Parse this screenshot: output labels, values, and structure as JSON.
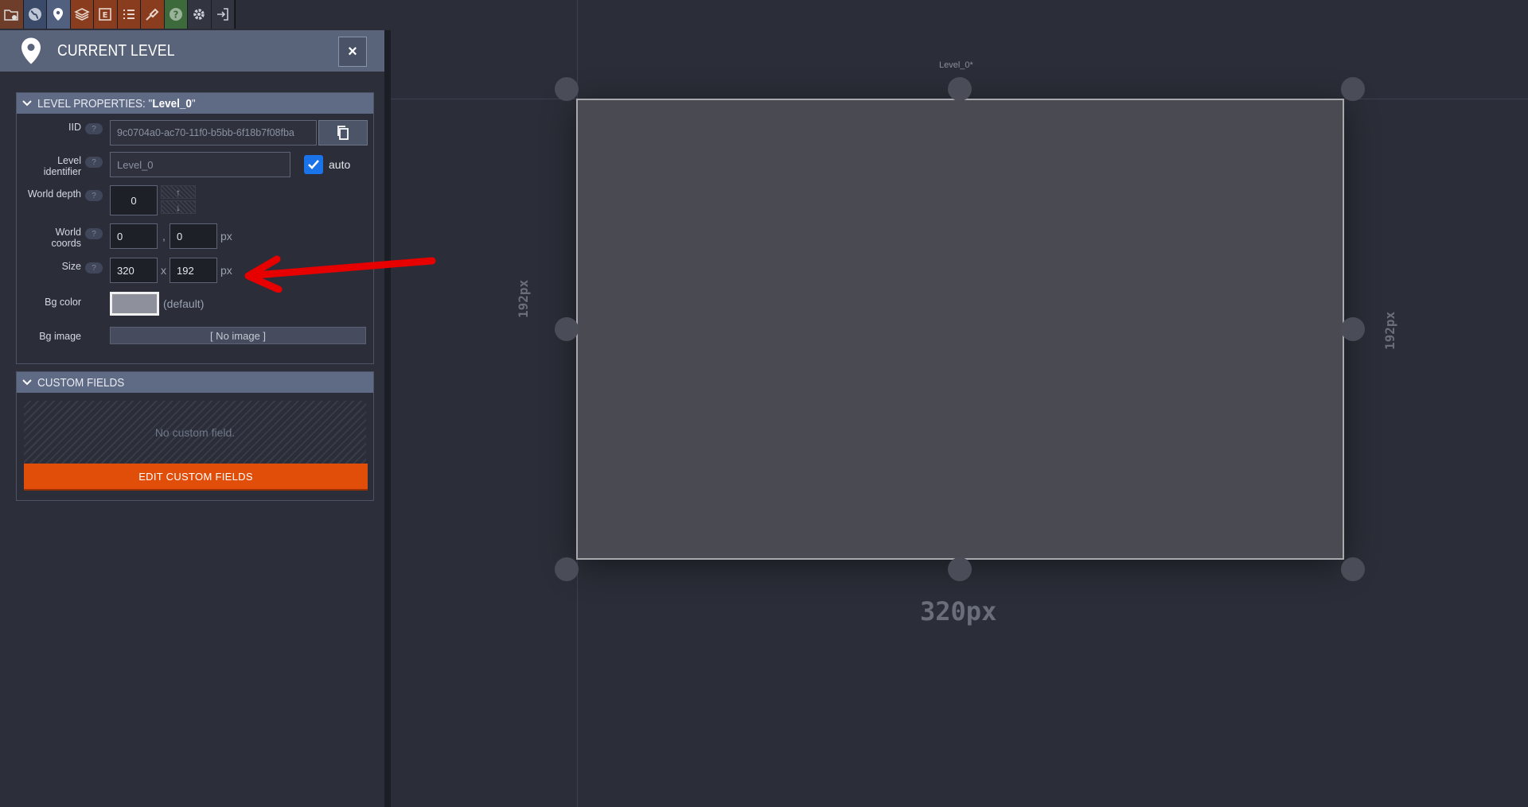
{
  "toolbar": {
    "buttons": [
      {
        "icon": "project-settings-icon"
      },
      {
        "icon": "world-icon"
      },
      {
        "icon": "level-pin-icon"
      },
      {
        "icon": "layers-icon"
      },
      {
        "icon": "entities-icon"
      },
      {
        "icon": "enums-icon"
      },
      {
        "icon": "tilesets-icon"
      },
      {
        "icon": "help-icon"
      },
      {
        "icon": "settings-icon"
      },
      {
        "icon": "exit-icon"
      }
    ]
  },
  "panel": {
    "title": "CURRENT LEVEL",
    "close_label": "×"
  },
  "level_properties": {
    "header_prefix": "LEVEL PROPERTIES: \"",
    "header_name": "Level_0",
    "header_suffix": "\"",
    "help_glyph": "?",
    "iid": {
      "label": "IID",
      "value": "9c0704a0-ac70-11f0-b5bb-6f18b7f08fba"
    },
    "identifier": {
      "label_line1": "Level",
      "label_line2": "identifier",
      "value": "Level_0",
      "auto_label": "auto",
      "auto_checked": true
    },
    "world_depth": {
      "label": "World depth",
      "value": "0"
    },
    "world_coords": {
      "label_line1": "World",
      "label_line2": "coords",
      "x": "0",
      "separator": ",",
      "y": "0",
      "unit": "px"
    },
    "size": {
      "label": "Size",
      "width": "320",
      "separator": "x",
      "height": "192",
      "unit": "px"
    },
    "bg_color": {
      "label": "Bg color",
      "value_text": "(default)",
      "swatch": "#8e909c"
    },
    "bg_image": {
      "label": "Bg image",
      "button": "[ No image ]"
    }
  },
  "custom_fields": {
    "header": "CUSTOM FIELDS",
    "empty_text": "No custom field.",
    "edit_button": "EDIT CUSTOM FIELDS"
  },
  "canvas": {
    "level_name": "Level_0*",
    "width_label": "320px",
    "height_label_left": "192px",
    "height_label_right": "192px"
  },
  "colors": {
    "accent": "#e14e0a",
    "panel_header": "#596379",
    "checkbox": "#1a73e8",
    "annotation_arrow": "#e60000"
  }
}
